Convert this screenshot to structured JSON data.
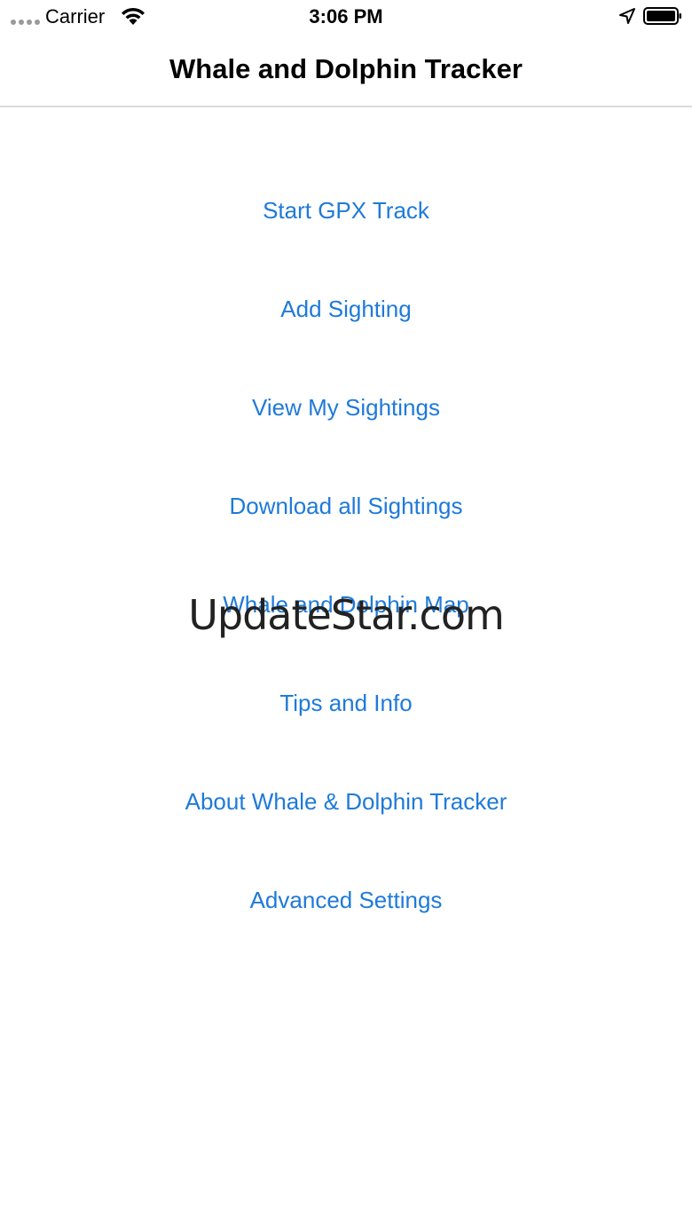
{
  "status_bar": {
    "carrier": "Carrier",
    "time": "3:06 PM",
    "signal_icon": "signal-dots-icon",
    "wifi_icon": "wifi-icon",
    "location_icon": "location-arrow-icon",
    "battery_icon": "battery-icon"
  },
  "nav": {
    "title": "Whale and Dolphin Tracker"
  },
  "menu": {
    "items": [
      {
        "label": "Start GPX Track"
      },
      {
        "label": "Add Sighting"
      },
      {
        "label": "View My Sightings"
      },
      {
        "label": "Download all Sightings"
      },
      {
        "label": "Whale and Dolphin Map"
      },
      {
        "label": "Tips and Info"
      },
      {
        "label": "About Whale & Dolphin Tracker"
      },
      {
        "label": "Advanced Settings"
      }
    ]
  },
  "watermark": {
    "text": "UpdateStar.com"
  },
  "colors": {
    "link": "#1e7ad9",
    "text": "#000000",
    "divider": "#dcdcdc"
  }
}
